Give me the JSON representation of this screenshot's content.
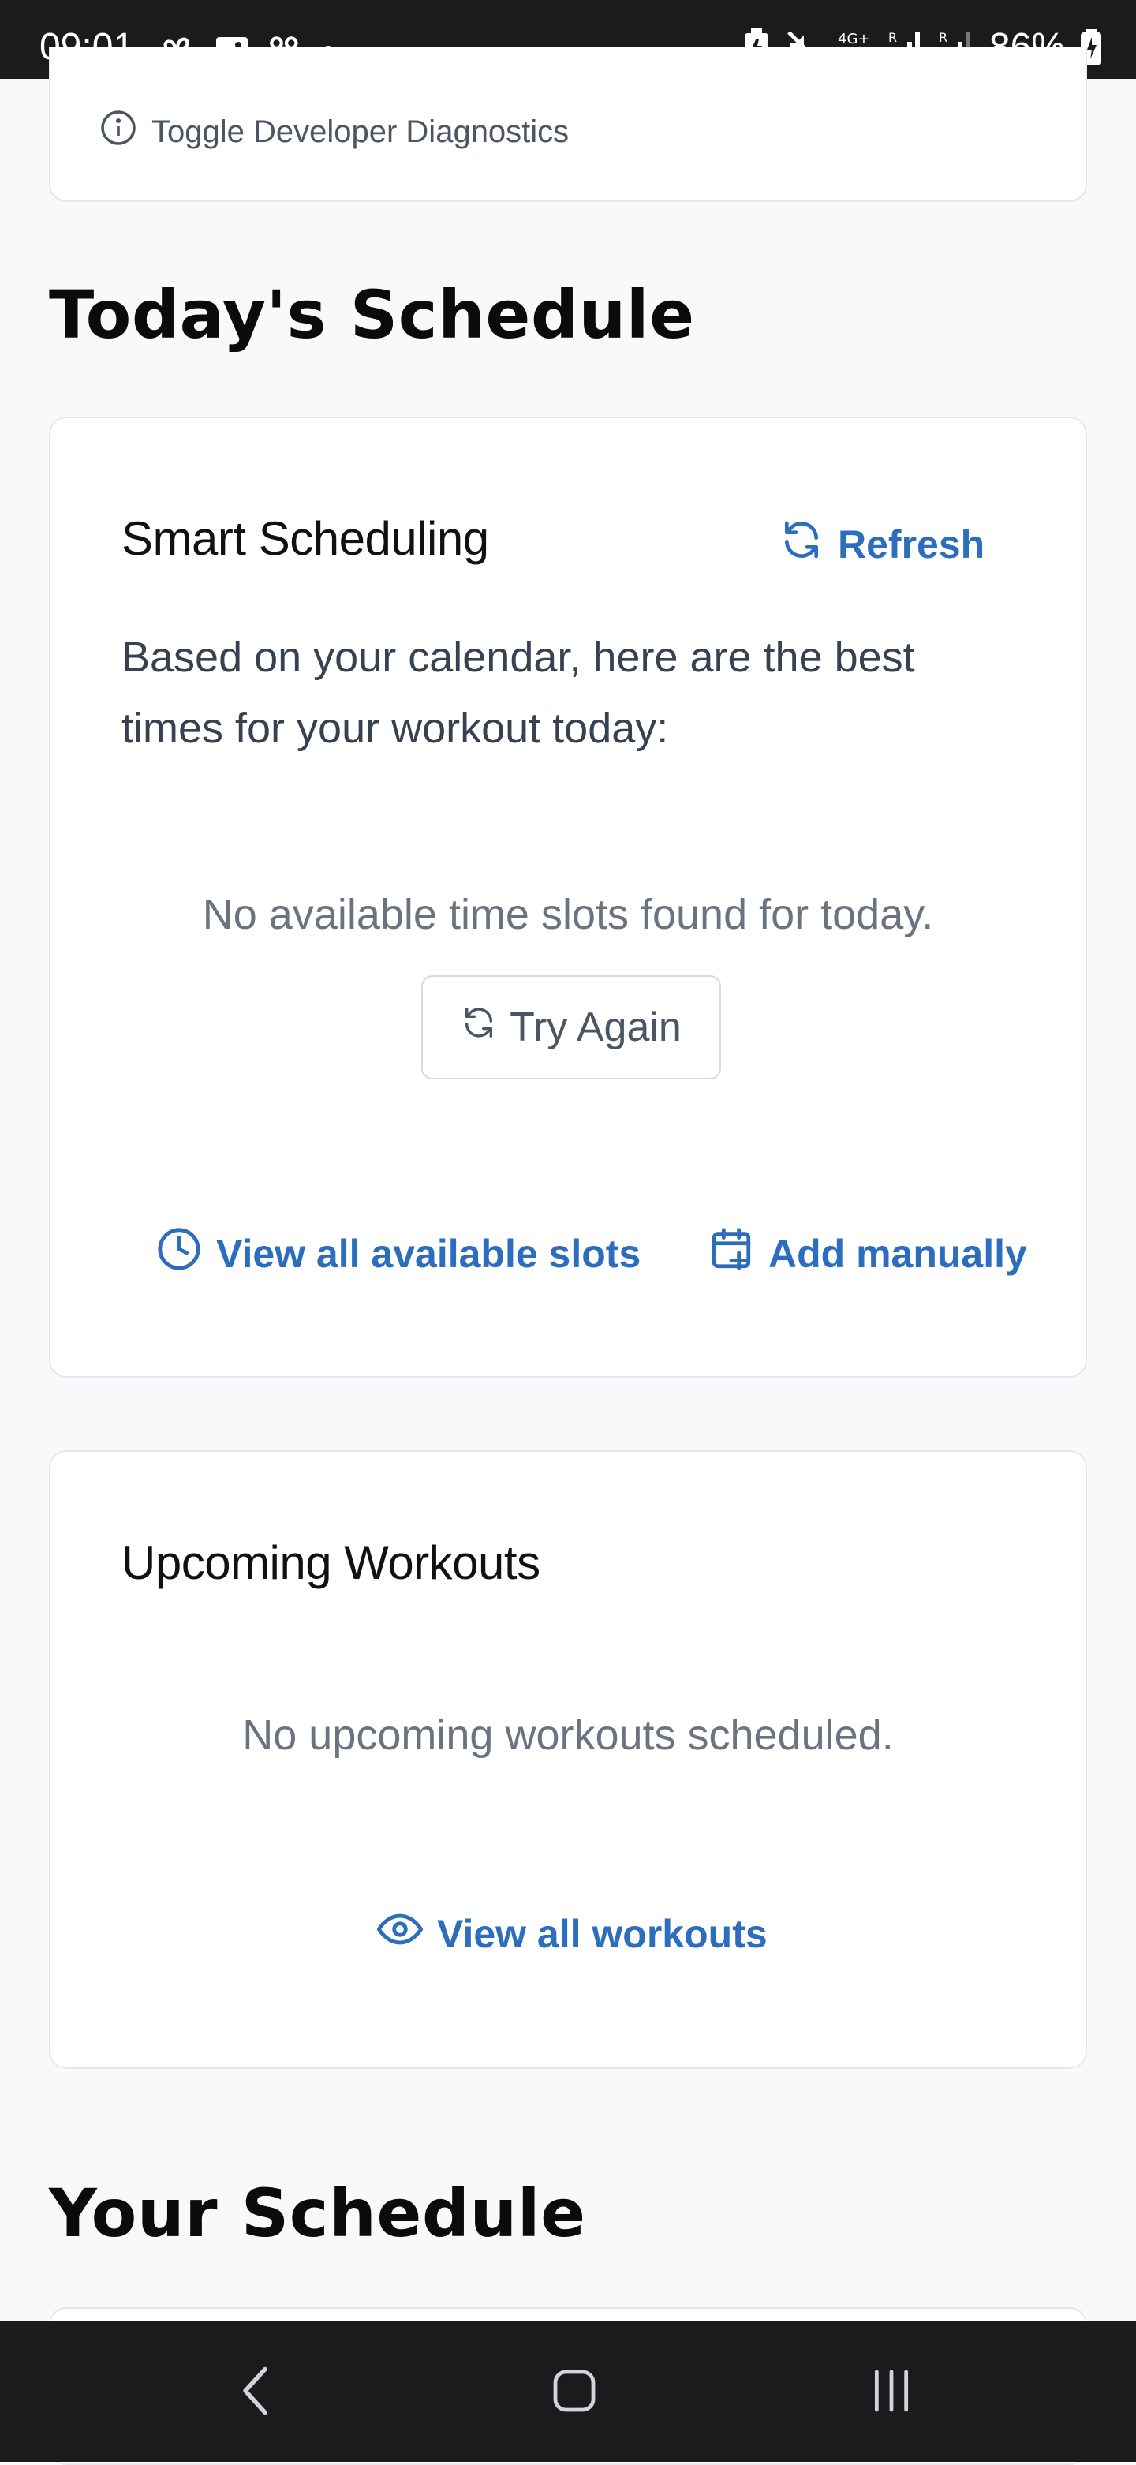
{
  "status_bar": {
    "time": "09:01",
    "battery": "86%",
    "left_icons": [
      "fan-icon",
      "gallery-icon",
      "voicemail-icon",
      "dot-icon"
    ],
    "right_icons": [
      "battery-saver-icon",
      "mute-icon",
      "4g-icon",
      "signal-icon",
      "signal-icon",
      "battery-icon"
    ]
  },
  "diagnostics": {
    "label": "Toggle Developer Diagnostics"
  },
  "todays_schedule": {
    "title": "Today's Schedule"
  },
  "smart_scheduling": {
    "title": "Smart Scheduling",
    "refresh_label": "Refresh",
    "description": "Based on your calendar, here are the best times for your workout today:",
    "empty_message": "No available time slots found for today.",
    "try_again_label": "Try Again",
    "view_slots_label": "View all available slots",
    "add_manually_label": "Add manually"
  },
  "upcoming_workouts": {
    "title": "Upcoming Workouts",
    "empty_message": "No upcoming workouts scheduled.",
    "view_all_label": "View all workouts"
  },
  "your_schedule": {
    "title": "Your Schedule"
  },
  "colors": {
    "accent": "#2c6dbd",
    "background": "#f8f9fb",
    "system_bar": "#1b1b1d"
  }
}
